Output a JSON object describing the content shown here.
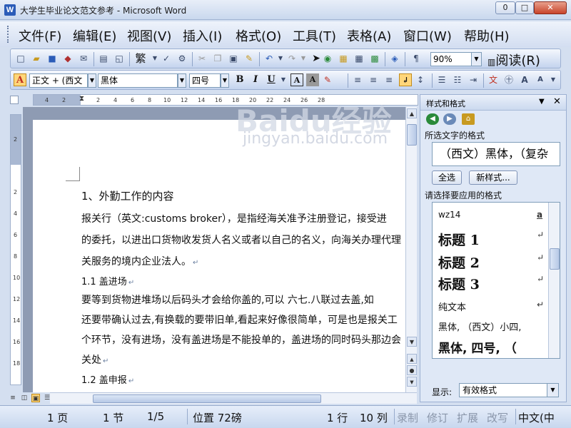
{
  "window": {
    "title": "大学生毕业论文范文参考 - Microsoft Word",
    "app_icon": "W",
    "min": "0",
    "max": "□",
    "close": "✕"
  },
  "menubar": {
    "items": [
      "文件(F)",
      "编辑(E)",
      "视图(V)",
      "插入(I)",
      "格式(O)",
      "工具(T)",
      "表格(A)",
      "窗口(W)",
      "帮助(H)"
    ]
  },
  "toolbar_standard": {
    "zoom": "90%",
    "read_label": "阅读(R)",
    "traditional_label": "繁"
  },
  "toolbar_format": {
    "style": "正文 + (西文",
    "font": "黑体",
    "size": "四号",
    "bold": "B",
    "italic": "I",
    "underline": "U",
    "font_color": "A"
  },
  "ruler": {
    "ticks": [
      "4",
      "2",
      "2",
      "4",
      "6",
      "8",
      "10",
      "12",
      "14",
      "16",
      "18",
      "20",
      "22",
      "24",
      "26",
      "28"
    ],
    "vticks": [
      "2",
      "2",
      "4",
      "6",
      "8",
      "10",
      "12",
      "14",
      "16",
      "18"
    ]
  },
  "document": {
    "lines": [
      {
        "text": "1、外勤工作的内容",
        "style": "h"
      },
      {
        "text": "    报关行（英文:customs broker），是指经海关准予注册登记，接受进",
        "style": "p"
      },
      {
        "text": "的委托，以进出口货物收发货人名义或者以自己的名义，向海关办理代理",
        "style": "p"
      },
      {
        "text": "关服务的境内企业法人。",
        "style": "p"
      },
      {
        "text": "1.1 盖进场",
        "style": "s"
      },
      {
        "text": "    要等到货物进堆场以后码头才会给你盖的,可以 六七.八联过去盖,如",
        "style": "p"
      },
      {
        "text": "还要带确认过去,有换载的要带旧单,看起来好像很简单，可是也是报关工",
        "style": "p"
      },
      {
        "text": "个环节，没有进场，没有盖进场是不能投单的，盖进场的同时码头那边会",
        "style": "p"
      },
      {
        "text": "关处",
        "style": "p"
      },
      {
        "text": "1.2 盖申报",
        "style": "s"
      }
    ]
  },
  "taskpane": {
    "title": "样式和格式",
    "selected_label": "所选文字的格式",
    "selected_value": "（西文）黑体，（复杂",
    "btn_select_all": "全选",
    "btn_new_style": "新样式...",
    "apply_label": "请选择要应用的格式",
    "styles": [
      {
        "name": "wz14",
        "mark": "a"
      },
      {
        "name": "标题 1",
        "mark": "↵"
      },
      {
        "name": "标题 2",
        "mark": "↵"
      },
      {
        "name": "标题 3",
        "mark": "↵"
      },
      {
        "name": "纯文本",
        "mark": "↵"
      },
      {
        "name": "黑体, （西文）小四,",
        "mark": ""
      },
      {
        "name": "黑体, 四号, （",
        "mark": ""
      }
    ],
    "show_label": "显示:",
    "show_value": "有效格式"
  },
  "statusbar": {
    "page": "1 页",
    "section": "1 节",
    "pages": "1/5",
    "position": "位置 72磅",
    "line": "1 行",
    "column": "10 列",
    "rec": "录制",
    "trk": "修订",
    "ext": "扩展",
    "ovr": "改写",
    "lang": "中文(中"
  },
  "watermark": {
    "main": "Baidu经验",
    "sub": "jingyan.baidu.com"
  },
  "colors": {
    "accent": "#2b5cb8",
    "active_button": "#ffd67a",
    "close_button": "#c8442b"
  }
}
